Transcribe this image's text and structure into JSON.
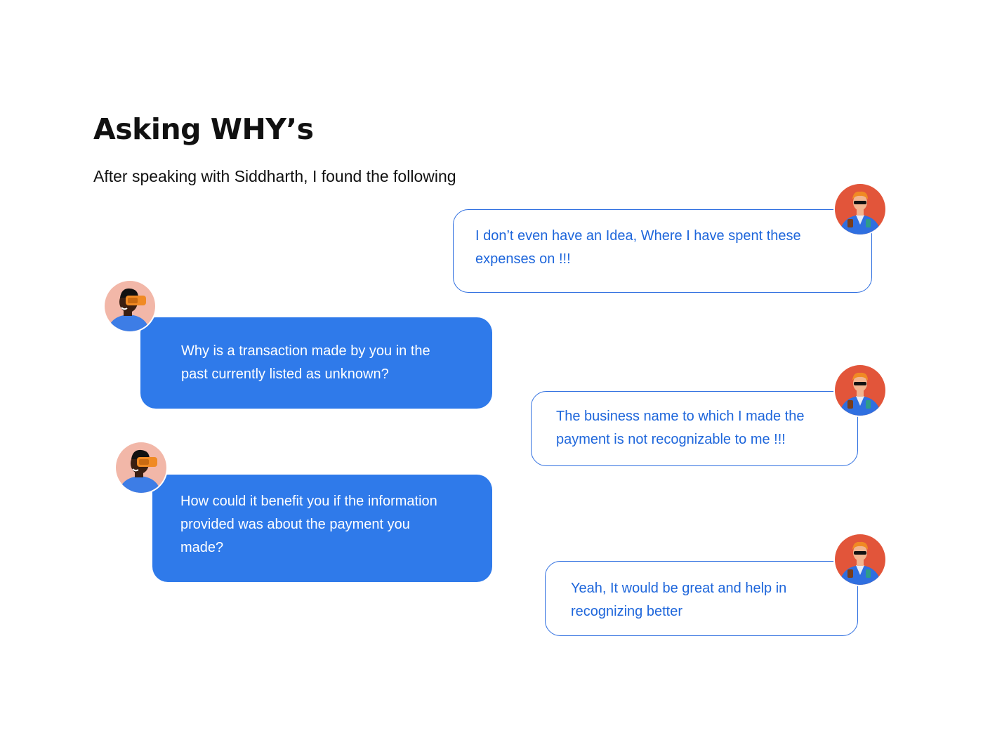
{
  "header": {
    "title": "Asking WHY’s",
    "subtitle": "After speaking with Siddharth, I found the following"
  },
  "conversation": {
    "reply_1": "I don’t even have an Idea,  Where I have spent these\nexpenses on !!!",
    "question_1": "Why is a transaction made by you in the\npast currently listed as unknown?",
    "reply_2": "The business name to which I made the\npayment is not recognizable to me !!!",
    "question_2": "How could it benefit you if the information\nprovided was about the payment you\nmade?",
    "reply_3": "Yeah, It would be great and help in\nrecognizing better"
  },
  "colors": {
    "accent": "#2f7aea",
    "outline_text": "#1e66db",
    "interviewer_avatar_bg": "#f2b7a8",
    "user_avatar_bg": "#e2553a",
    "jacket": "#2f6fe0"
  },
  "icons": {
    "interviewer": "interviewer-avatar-icon",
    "user": "user-avatar-icon"
  }
}
